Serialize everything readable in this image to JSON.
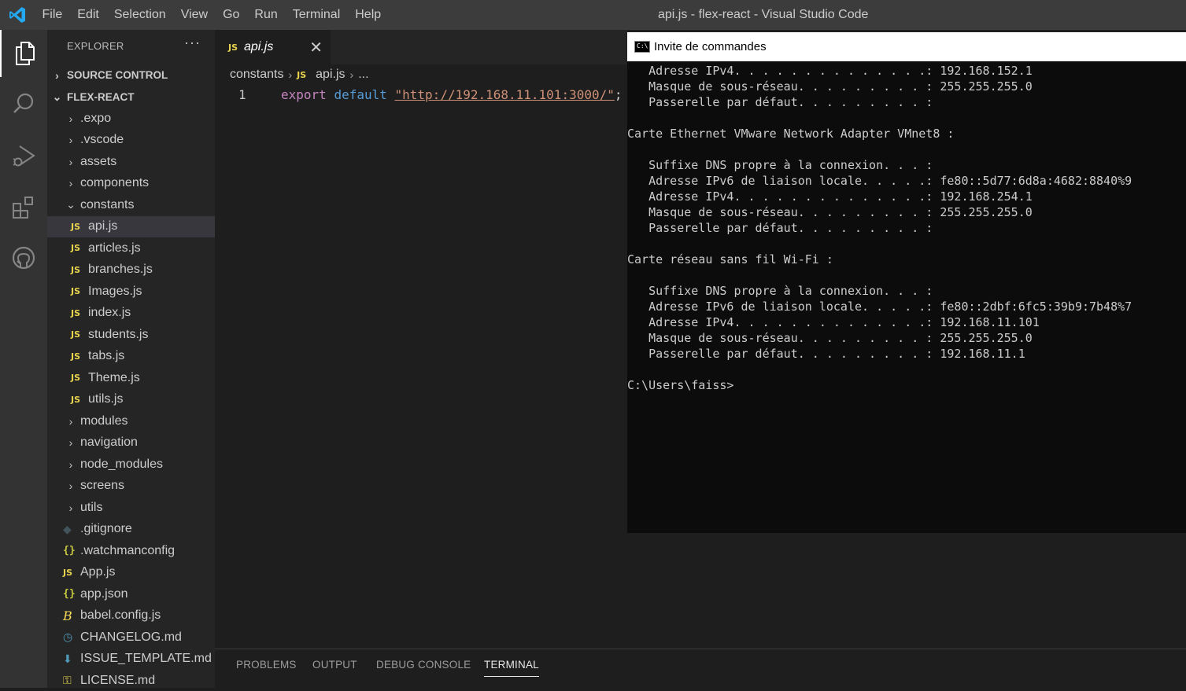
{
  "menu": [
    "File",
    "Edit",
    "Selection",
    "View",
    "Go",
    "Run",
    "Terminal",
    "Help"
  ],
  "window_title": "api.js - flex-react - Visual Studio Code",
  "explorer": {
    "title": "EXPLORER",
    "more": "···",
    "source_control": "SOURCE CONTROL",
    "project": "FLEX-REACT",
    "js_badge": "JS",
    "items": [
      {
        "label": ".expo",
        "type": "folder"
      },
      {
        "label": ".vscode",
        "type": "folder"
      },
      {
        "label": "assets",
        "type": "folder"
      },
      {
        "label": "components",
        "type": "folder"
      },
      {
        "label": "constants",
        "type": "folder-open"
      },
      {
        "label": "api.js",
        "type": "js"
      },
      {
        "label": "articles.js",
        "type": "js"
      },
      {
        "label": "branches.js",
        "type": "js"
      },
      {
        "label": "Images.js",
        "type": "js"
      },
      {
        "label": "index.js",
        "type": "js"
      },
      {
        "label": "students.js",
        "type": "js"
      },
      {
        "label": "tabs.js",
        "type": "js"
      },
      {
        "label": "Theme.js",
        "type": "js"
      },
      {
        "label": "utils.js",
        "type": "js"
      },
      {
        "label": "modules",
        "type": "folder"
      },
      {
        "label": "navigation",
        "type": "folder"
      },
      {
        "label": "node_modules",
        "type": "folder"
      },
      {
        "label": "screens",
        "type": "folder"
      },
      {
        "label": "utils",
        "type": "folder"
      },
      {
        "label": ".gitignore",
        "type": "git"
      },
      {
        "label": ".watchmanconfig",
        "type": "json"
      },
      {
        "label": "App.js",
        "type": "js"
      },
      {
        "label": "app.json",
        "type": "json"
      },
      {
        "label": "babel.config.js",
        "type": "babel"
      },
      {
        "label": "CHANGELOG.md",
        "type": "md-clock"
      },
      {
        "label": "ISSUE_TEMPLATE.md",
        "type": "md-down"
      },
      {
        "label": "LICENSE.md",
        "type": "md-key"
      }
    ]
  },
  "editor": {
    "tab_label": "api.js",
    "breadcrumb": {
      "folder": "constants",
      "file": "api.js",
      "more": "..."
    },
    "line_number": "1",
    "code": {
      "kw1": "export",
      "kw2": "default",
      "string": "\"http://192.168.11.101:3000/\"",
      "end": ";"
    }
  },
  "panel": {
    "tabs": [
      "PROBLEMS",
      "OUTPUT",
      "DEBUG CONSOLE",
      "TERMINAL"
    ],
    "active": "TERMINAL"
  },
  "cmd": {
    "title": "Invite de commandes",
    "icon_text": "C:\\",
    "lines": [
      "   Adresse IPv4. . . . . . . . . . . . . .: 192.168.152.1",
      "   Masque de sous-réseau. . . . . . . . . : 255.255.255.0",
      "   Passerelle par défaut. . . . . . . . . :",
      "",
      "Carte Ethernet VMware Network Adapter VMnet8 :",
      "",
      "   Suffixe DNS propre à la connexion. . . :",
      "   Adresse IPv6 de liaison locale. . . . .: fe80::5d77:6d8a:4682:8840%9",
      "   Adresse IPv4. . . . . . . . . . . . . .: 192.168.254.1",
      "   Masque de sous-réseau. . . . . . . . . : 255.255.255.0",
      "   Passerelle par défaut. . . . . . . . . :",
      "",
      "Carte réseau sans fil Wi-Fi :",
      "",
      "   Suffixe DNS propre à la connexion. . . :",
      "   Adresse IPv6 de liaison locale. . . . .: fe80::2dbf:6fc5:39b9:7b48%7",
      "   Adresse IPv4. . . . . . . . . . . . . .: 192.168.11.101",
      "   Masque de sous-réseau. . . . . . . . . : 255.255.255.0",
      "   Passerelle par défaut. . . . . . . . . : 192.168.11.1",
      "",
      "C:\\Users\\faiss>"
    ]
  },
  "colors": {
    "titlebar": "#3c3c3c",
    "activitybar": "#333333",
    "sidebar": "#252526",
    "editor": "#1e1e1e",
    "selected_row": "#37373d",
    "js_yellow": "#e8d44d",
    "string": "#ce9178",
    "keyword": "#c586c0"
  }
}
